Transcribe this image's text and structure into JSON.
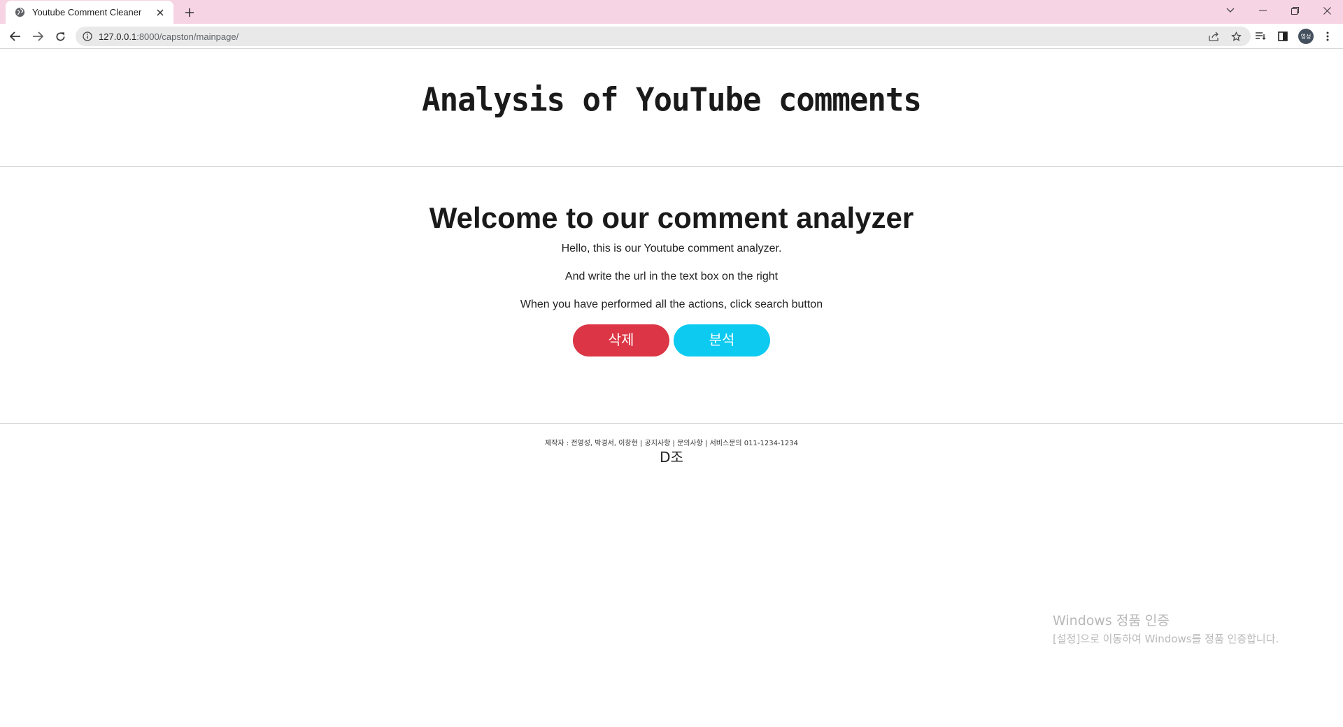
{
  "browser": {
    "tab_title": "Youtube Comment Cleaner",
    "url_host": "127.0.0.1",
    "url_path": ":8000/capston/mainpage/",
    "profile_initials": "영성",
    "titlebar_color": "#f7d4e3"
  },
  "page": {
    "site_title": "Analysis of YouTube comments",
    "welcome_heading": "Welcome to our comment analyzer",
    "paragraphs": [
      "Hello, this is our Youtube comment analyzer.",
      "And write the url in the text box on the right",
      "When you have performed all the actions, click search button"
    ],
    "buttons": {
      "delete_label": "삭제",
      "delete_color": "#dc3545",
      "analyze_label": "분석",
      "analyze_color": "#0dcaf0"
    },
    "footer": {
      "info": "제작자 : 전영성, 박경서, 이창현 | 공지사항 | 문의사항 | 서비스문의 011-1234-1234",
      "team": "D조"
    }
  },
  "os_overlay": {
    "activation_title": "Windows 정품 인증",
    "activation_subtitle": "[설정]으로 이동하여 Windows를 정품 인증합니다."
  }
}
